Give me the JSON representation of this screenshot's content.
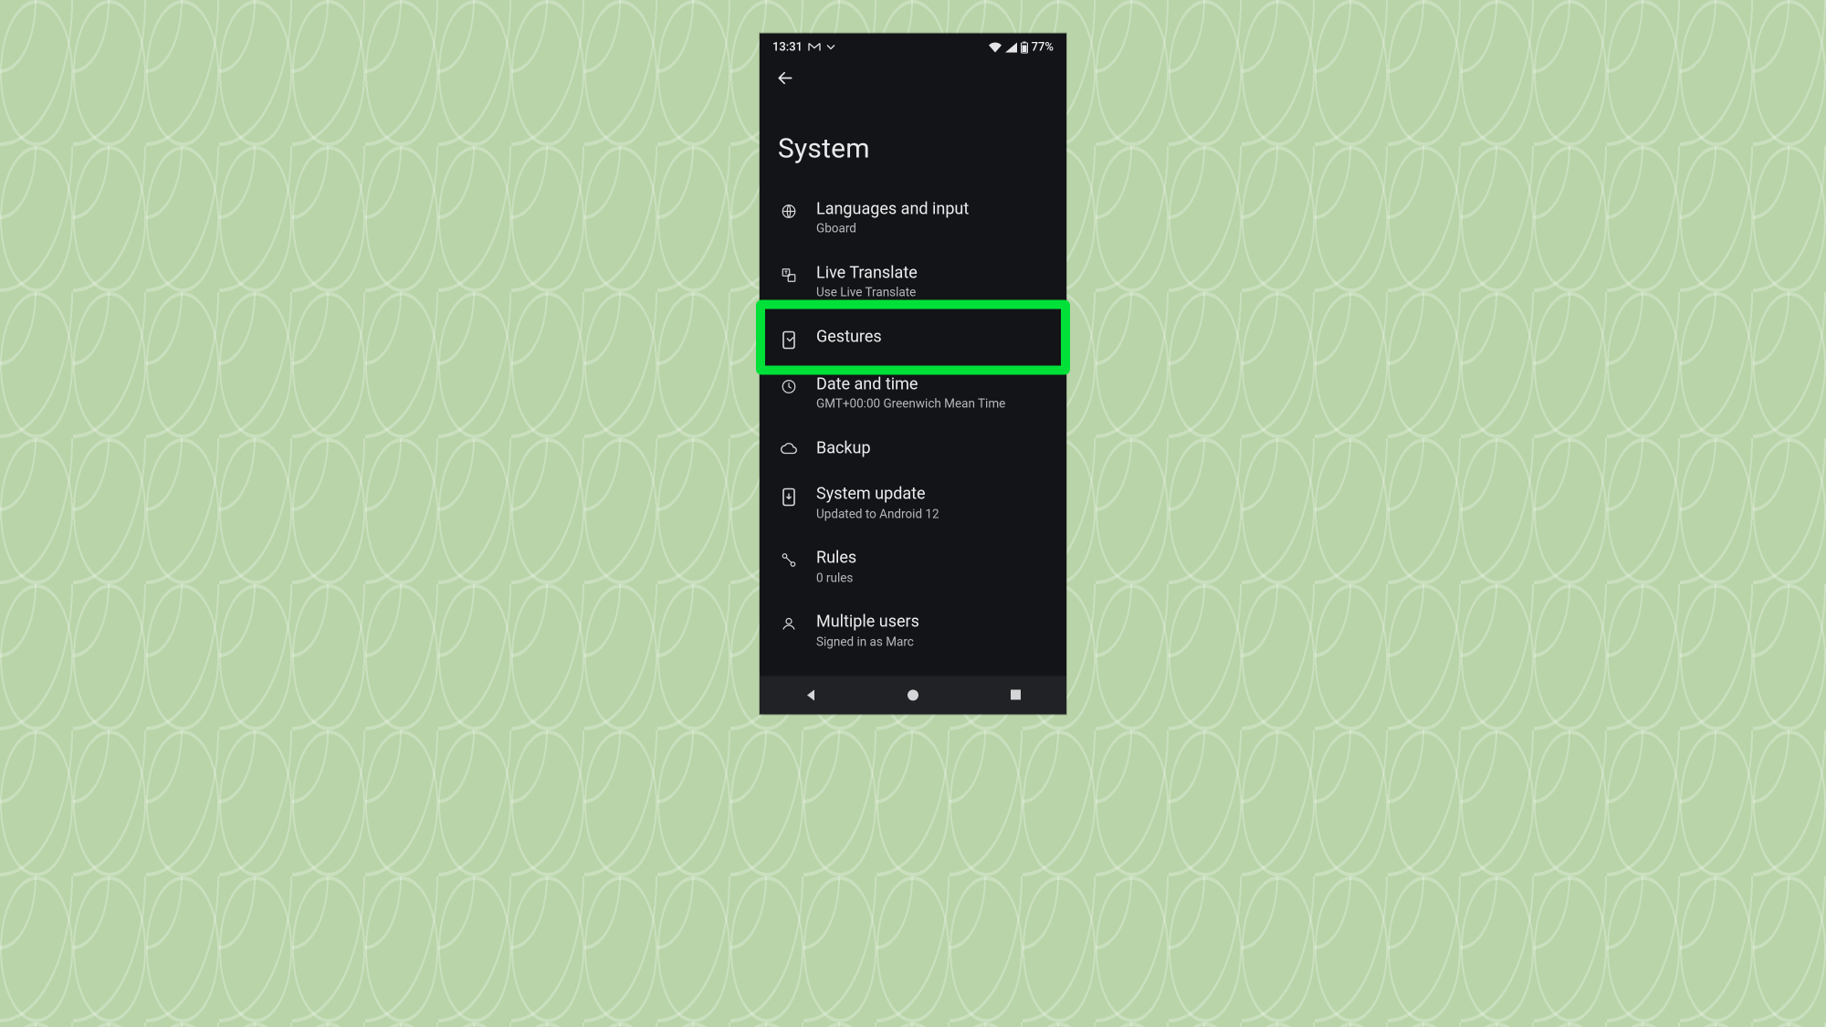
{
  "statusbar": {
    "time": "13:31",
    "battery": "77%"
  },
  "page": {
    "title": "System"
  },
  "items": [
    {
      "label": "Languages and input",
      "sub": "Gboard",
      "icon": "globe"
    },
    {
      "label": "Live Translate",
      "sub": "Use Live Translate",
      "icon": "translate"
    },
    {
      "label": "Gestures",
      "sub": "",
      "icon": "gesture"
    },
    {
      "label": "Date and time",
      "sub": "GMT+00:00 Greenwich Mean Time",
      "icon": "clock"
    },
    {
      "label": "Backup",
      "sub": "",
      "icon": "cloud"
    },
    {
      "label": "System update",
      "sub": "Updated to Android 12",
      "icon": "update"
    },
    {
      "label": "Rules",
      "sub": "0 rules",
      "icon": "rules"
    },
    {
      "label": "Multiple users",
      "sub": "Signed in as Marc",
      "icon": "person"
    }
  ],
  "highlight_index": 2
}
